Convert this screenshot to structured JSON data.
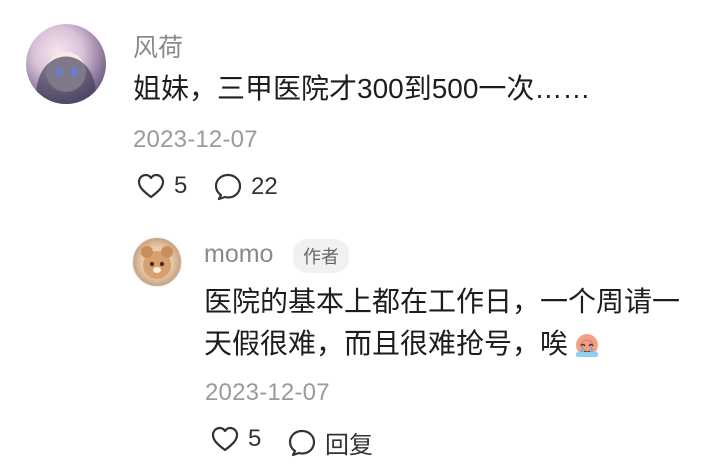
{
  "comment": {
    "username": "风荷",
    "text": "姐妹，三甲医院才300到500一次……",
    "date": "2023-12-07",
    "likes": "5",
    "replies": "22"
  },
  "reply": {
    "username": "momo",
    "author_badge": "作者",
    "text_line1": "医院的基本上都在工作日，一个周请一",
    "text_line2": "天假很难，而且很难抢号，唉",
    "date": "2023-12-07",
    "likes": "5",
    "reply_label": "回复"
  },
  "icons": {
    "like": "heart-outline-icon",
    "comment": "speech-bubble-icon",
    "emoji": "crying-emoji-icon"
  }
}
